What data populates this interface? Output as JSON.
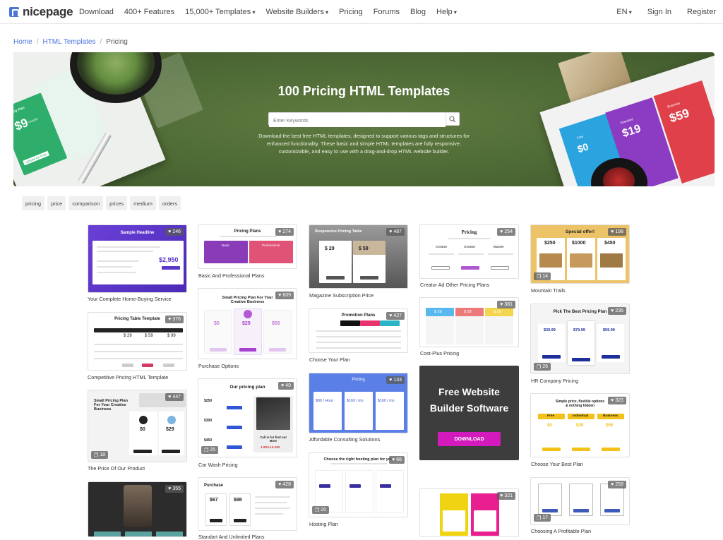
{
  "header": {
    "logo": "nicepage",
    "nav": [
      "Download",
      "400+ Features",
      "15,000+ Templates",
      "Website Builders",
      "Pricing",
      "Forums",
      "Blog",
      "Help"
    ],
    "lang": "EN",
    "sign_in": "Sign In",
    "register": "Register"
  },
  "breadcrumb": [
    "Home",
    "HTML Templates",
    "Pricing"
  ],
  "hero": {
    "title": "100 Pricing HTML Templates",
    "search_placeholder": "Enter Keywords",
    "description": "Download the best free HTML templates, designed to support various tags and structures for enhanced functionality. These basic and simple HTML templates are fully responsive, customizable, and easy to use with a drag-and-drop HTML website builder.",
    "deco": {
      "left_price": "$9",
      "left_per": "/month",
      "left_tag": "Yearly Plan",
      "left_cta": "Upload for Free",
      "right_free": "$0",
      "right_mid": "$19",
      "right_high": "$59",
      "right_free_label": "Free",
      "right_mid_label": "Standard",
      "right_high_label": "Business"
    }
  },
  "tags": [
    "pricing",
    "price",
    "comparison",
    "prices",
    "medium",
    "orders"
  ],
  "templates": [
    {
      "name": "Your Complete Home-Buying Service",
      "likes": "246",
      "thumb_title": "Sample Headline",
      "price": "$2,950"
    },
    {
      "name": "Competitive Pricing HTML Template",
      "likes": "376",
      "thumb_title": "Pricing Table Template",
      "prices": [
        "$ 29",
        "$ 59",
        "$ 99"
      ]
    },
    {
      "name": "The Price Of Our Product",
      "likes": "447",
      "pages": "18",
      "thumb_title": "Small Pricing Plan For Your Creative Business",
      "prices": [
        "$0",
        "$29"
      ]
    },
    {
      "name": "",
      "likes": "355"
    },
    {
      "name": "Basic And Professional Plans",
      "likes": "274",
      "thumb_title": "Pricing Plans",
      "plans": [
        "Basic",
        "Professional"
      ]
    },
    {
      "name": "Purchase Options",
      "likes": "609",
      "thumb_title": "Small Pricing Plan For Your Creative Business",
      "prices": [
        "$0",
        "$29",
        "$59"
      ]
    },
    {
      "name": "Car Wash Pricing",
      "likes": "49",
      "pages": "25",
      "thumb_title": "Our pricing plan",
      "prices": [
        "$250",
        "$300",
        "$450"
      ],
      "call": "Call in for find out More",
      "phone": "1-800-10-300"
    },
    {
      "name": "Standart And Unlimited Plans",
      "likes": "428",
      "thumb_title": "Purchase",
      "prices": [
        "$67",
        "$98"
      ]
    },
    {
      "name": "Magazine Subscription Price",
      "likes": "487",
      "thumb_title": "Responsive Pricing Table",
      "prices": [
        "$ 29",
        "$ 59"
      ]
    },
    {
      "name": "Choose Your Plan",
      "likes": "427",
      "thumb_title": "Promotion Plans"
    },
    {
      "name": "Affordable Consulting Solutions",
      "likes": "133",
      "thumb_title": "Pricing",
      "prices": [
        "$80 / Hour",
        "$160 / mo",
        "$160 / mo"
      ]
    },
    {
      "name": "Hosting Plan",
      "likes": "66",
      "pages": "20",
      "thumb_title": "Choose the right hosting plan for you"
    },
    {
      "name": "Creator Ad Other Pricing Plans",
      "likes": "254",
      "thumb_title": "Pricing",
      "plans": [
        "Creator",
        "Creator",
        "Master"
      ]
    },
    {
      "name": "Cost-Plus Pricing",
      "likes": "381",
      "prices": [
        "$ 29",
        "$ 59",
        "$ 29"
      ]
    },
    {
      "name": "",
      "likes": "321"
    },
    {
      "name": "Mountain Trails",
      "likes": "198",
      "pages": "14",
      "thumb_title": "Special offer!",
      "prices": [
        "$250",
        "$1000",
        "$450"
      ]
    },
    {
      "name": "HR Company Pricing",
      "likes": "235",
      "pages": "26",
      "thumb_title": "Pick The Best Pricing Plan",
      "prices": [
        "$39.99",
        "$79.99",
        "$59.99"
      ]
    },
    {
      "name": "Choose Your Best Plan",
      "likes": "323",
      "thumb_title": "Simple price, flexible options & nothing hidden",
      "plans": [
        "Free",
        "Individual",
        "Business"
      ],
      "prices": [
        "$0",
        "$29",
        "$59"
      ]
    },
    {
      "name": "Choosing A Profitable Plan",
      "likes": "259",
      "pages": "17"
    }
  ],
  "ad": {
    "title_line1": "Free Website",
    "title_line2": "Builder Software",
    "button": "DOWNLOAD"
  },
  "colors": {
    "accent": "#4a74d8",
    "ad_button": "#d31bbd",
    "hero_bg": "#4d6933"
  }
}
